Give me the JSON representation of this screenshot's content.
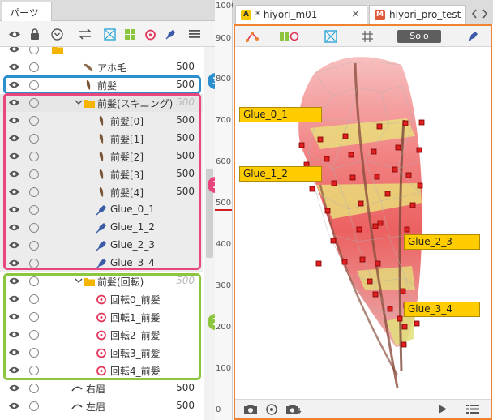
{
  "parts_panel": {
    "tab_label": "パーツ",
    "rows": [
      {
        "label": "アホ毛",
        "value": "500"
      },
      {
        "label": "前髪",
        "value": "500"
      },
      {
        "label": "前髪(スキニング)",
        "value": "500"
      },
      {
        "label": "前髪[0]",
        "value": "500"
      },
      {
        "label": "前髪[1]",
        "value": "500"
      },
      {
        "label": "前髪[2]",
        "value": "500"
      },
      {
        "label": "前髪[3]",
        "value": "500"
      },
      {
        "label": "前髪[4]",
        "value": "500"
      },
      {
        "label": "Glue_0_1",
        "value": ""
      },
      {
        "label": "Glue_1_2",
        "value": ""
      },
      {
        "label": "Glue_2_3",
        "value": ""
      },
      {
        "label": "Glue_3_4",
        "value": ""
      },
      {
        "label": "前髪(回転)",
        "value": "500"
      },
      {
        "label": "回転0_前髪",
        "value": ""
      },
      {
        "label": "回転1_前髪",
        "value": ""
      },
      {
        "label": "回転2_前髪",
        "value": ""
      },
      {
        "label": "回転3_前髪",
        "value": ""
      },
      {
        "label": "回転4_前髪",
        "value": ""
      },
      {
        "label": "右眉",
        "value": "500"
      },
      {
        "label": "左眉",
        "value": "500"
      }
    ]
  },
  "callouts": [
    {
      "number": "1",
      "color": "#e8467c"
    },
    {
      "number": "2",
      "color": "#8cc63f"
    },
    {
      "number": "3",
      "color": "#2b8fcf"
    }
  ],
  "ruler": {
    "ticks": [
      "1000",
      "900",
      "800",
      "700",
      "600",
      "500",
      "400",
      "300",
      "200",
      "100",
      "0"
    ]
  },
  "view_panel": {
    "tabs": [
      {
        "label": "* hiyori_m01",
        "icon_letter": "A"
      },
      {
        "label": "hiyori_pro_test",
        "icon_letter": "M"
      }
    ],
    "solo_label": "Solo",
    "glue_labels": [
      "Glue_0_1",
      "Glue_1_2",
      "Glue_2_3",
      "Glue_3_4"
    ]
  },
  "colors": {
    "accent": "#f08232",
    "glue": "#ffcc00",
    "folder": "#f5b400",
    "rotation": "#e2365a",
    "pen": "#3b5ba9"
  },
  "icons": [
    "eye-icon",
    "lock-icon",
    "chevron-circle-icon",
    "swap-icon",
    "warp-deformer-icon",
    "parts-grid-icon",
    "rotation-icon",
    "pen-icon",
    "menu-icon",
    "camera-icon",
    "play-icon",
    "list-icon"
  ]
}
